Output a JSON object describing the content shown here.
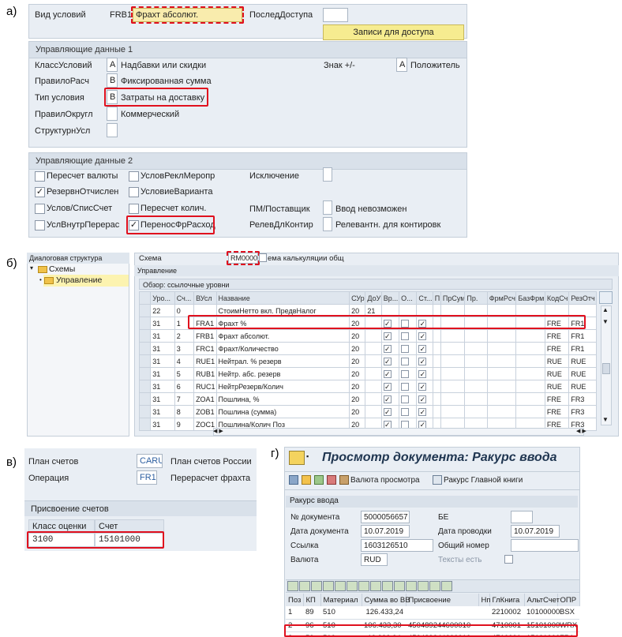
{
  "parts": {
    "a": "а)",
    "b": "б)",
    "v": "в)",
    "g": "г)"
  },
  "a": {
    "cond_type_label": "Вид условий",
    "cond_type_code": "FRB1",
    "cond_type_name": "Фрахт абсолют.",
    "access_seq_label": "ПоследДоступа",
    "access_seq_value": "",
    "records_button": "Записи для доступа",
    "ctrl1_title": "Управляющие данные 1",
    "ctrl1": [
      {
        "label": "КлассУсловий",
        "code": "A",
        "text": "Надбавки или скидки"
      },
      {
        "label": "ПравилоРасч",
        "code": "B",
        "text": "Фиксированная сумма"
      },
      {
        "label": "Тип условия",
        "code": "B",
        "text": "Затраты на доставку"
      },
      {
        "label": "ПравилОкругл",
        "code": "",
        "text": "Коммерческий"
      },
      {
        "label": "СтруктурнУсл",
        "code": "",
        "text": ""
      }
    ],
    "sign_label": "Знак +/-",
    "sign_code": "A",
    "sign_text": "Положитель",
    "ctrl2_title": "Управляющие данные 2",
    "ctrl2_col1": [
      {
        "label": "Пересчет валюты",
        "checked": false
      },
      {
        "label": "РезервнОтчислен",
        "checked": true
      },
      {
        "label": "Услов/СписСчет",
        "checked": false
      },
      {
        "label": "УслВнутрПерерас",
        "checked": false
      }
    ],
    "ctrl2_col2": [
      {
        "label": "УсловРеклМеропр",
        "checked": false
      },
      {
        "label": "УсловиеВарианта",
        "checked": false
      },
      {
        "label": "Пересчет колич.",
        "checked": false
      },
      {
        "label": "ПереносФрРасход",
        "checked": true
      }
    ],
    "exclusion_label": "Исключение",
    "vendor_label": "ПМ/Поставщик",
    "vendor_text": "Ввод невозможен",
    "acct_label": "РелевДлКонтир",
    "acct_text": "Релевантн. для контировк"
  },
  "b": {
    "tree_title": "Диалоговая структура",
    "tree_root": "Схемы",
    "tree_child": "Управление",
    "schema_label": "Схема",
    "schema_code": "RM0000",
    "schema_text": "ема калькуляции общ",
    "section_title": "Управление",
    "overview_title": "Обзор: ссылочные уровни",
    "columns": [
      "Уро...",
      "Сч...",
      "ВУсл",
      "Название",
      "СУр",
      "ДоУ",
      "Вр...",
      "О...",
      "Ст...",
      "П",
      "ПрСум",
      "Пр.",
      "ФрмРсч",
      "БазФрм",
      "КодСч",
      "РезОтч"
    ],
    "rows": [
      {
        "lvl": "22",
        "cnt": "0",
        "cond": "",
        "name": "СтоимНетто вкл. ПредвНалог",
        "from": "20",
        "to": "21",
        "c1": false,
        "c2": false,
        "c3": false,
        "code": "",
        "acc": ""
      },
      {
        "lvl": "31",
        "cnt": "1",
        "cond": "FRA1",
        "name": "Фрахт %",
        "from": "20",
        "to": "",
        "c1": true,
        "c2": false,
        "c3": true,
        "code": "FRE",
        "acc": "FR1"
      },
      {
        "lvl": "31",
        "cnt": "2",
        "cond": "FRB1",
        "name": "Фрахт абсолют.",
        "from": "20",
        "to": "",
        "c1": true,
        "c2": false,
        "c3": true,
        "code": "FRE",
        "acc": "FR1"
      },
      {
        "lvl": "31",
        "cnt": "3",
        "cond": "FRC1",
        "name": "Фрахт/Количество",
        "from": "20",
        "to": "",
        "c1": true,
        "c2": false,
        "c3": true,
        "code": "FRE",
        "acc": "FR1"
      },
      {
        "lvl": "31",
        "cnt": "4",
        "cond": "RUE1",
        "name": "Нейтрал. % резерв",
        "from": "20",
        "to": "",
        "c1": true,
        "c2": false,
        "c3": true,
        "code": "RUE",
        "acc": "RUE"
      },
      {
        "lvl": "31",
        "cnt": "5",
        "cond": "RUB1",
        "name": "Нейтр. абс. резерв",
        "from": "20",
        "to": "",
        "c1": true,
        "c2": false,
        "c3": true,
        "code": "RUE",
        "acc": "RUE"
      },
      {
        "lvl": "31",
        "cnt": "6",
        "cond": "RUC1",
        "name": "НейтрРезерв/Колич",
        "from": "20",
        "to": "",
        "c1": true,
        "c2": false,
        "c3": true,
        "code": "RUE",
        "acc": "RUE"
      },
      {
        "lvl": "31",
        "cnt": "7",
        "cond": "ZOA1",
        "name": "Пошлина, %",
        "from": "20",
        "to": "",
        "c1": true,
        "c2": false,
        "c3": true,
        "code": "FRE",
        "acc": "FR3"
      },
      {
        "lvl": "31",
        "cnt": "8",
        "cond": "ZOB1",
        "name": "Пошлина (сумма)",
        "from": "20",
        "to": "",
        "c1": true,
        "c2": false,
        "c3": true,
        "code": "FRE",
        "acc": "FR3"
      },
      {
        "lvl": "31",
        "cnt": "9",
        "cond": "ZOC1",
        "name": "Пошлина/Колич Поз",
        "from": "20",
        "to": "",
        "c1": true,
        "c2": false,
        "c3": true,
        "code": "FRE",
        "acc": "FR3"
      }
    ]
  },
  "v": {
    "chart_label": "План счетов",
    "chart_code": "CARU",
    "chart_text": "План счетов России",
    "op_label": "Операция",
    "op_code": "FR1",
    "op_text": "Перерасчет фрахта",
    "assign_title": "Присвоение счетов",
    "col1": "Класс оценки",
    "col2": "Счет",
    "val1": "3100",
    "val2": "15101000"
  },
  "g": {
    "title": "Просмотр документа: Ракурс ввода",
    "toolbar_currency": "Валюта просмотра",
    "toolbar_ledger": "Ракурс Главной книги",
    "section": "Ракурс ввода",
    "doc_no_label": "№ документа",
    "doc_no": "5000056657",
    "be_label": "БЕ",
    "be_value": "",
    "doc_date_label": "Дата документа",
    "doc_date": "10.07.2019",
    "post_date_label": "Дата проводки",
    "post_date": "10.07.2019",
    "ref_label": "Ссылка",
    "ref": "1603126510",
    "common_label": "Общий номер",
    "currency_label": "Валюта",
    "currency": "RUD",
    "texts_label": "Тексты есть",
    "columns": [
      "Поз",
      "КП",
      "Материал",
      "Сумма во ВВ",
      "Присвоение",
      "Нп",
      "ГлКнига",
      "АльтСчет",
      "ОПР"
    ],
    "rows": [
      {
        "pos": "1",
        "kp": "89",
        "mat": "510",
        "sum": "126.433,24",
        "assign": "",
        "np": "",
        "gl": "2210002",
        "alt": "10100000",
        "opr": "BSX"
      },
      {
        "pos": "2",
        "kp": "96",
        "mat": "510",
        "sum": "106.433,30-",
        "assign": "450489244600010",
        "np": "",
        "gl": "4710001",
        "alt": "15101000",
        "opr": "WRX"
      },
      {
        "pos": "3",
        "kp": "50",
        "mat": "510",
        "sum": "19.999,94-",
        "assign": "450489244600010",
        "np": "",
        "gl": "4710001",
        "alt": "15101000",
        "opr": "FR1"
      }
    ]
  }
}
